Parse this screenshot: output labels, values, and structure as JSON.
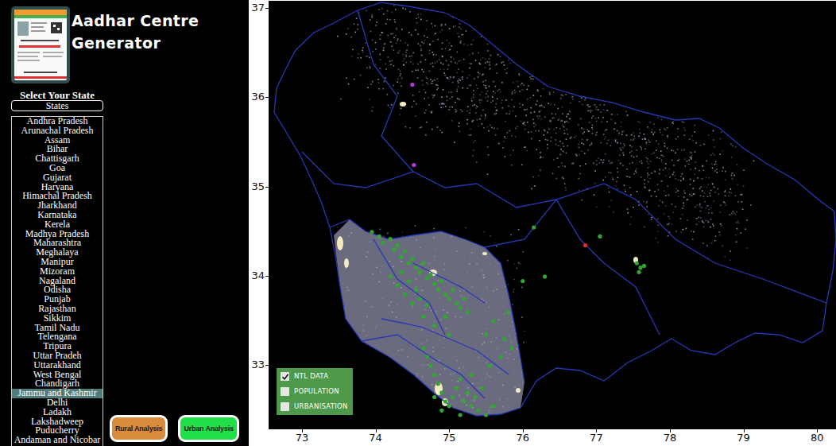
{
  "app": {
    "title": "Aadhar Centre Generator"
  },
  "state_picker": {
    "label": "Select Your State",
    "dropdown": "States"
  },
  "states": [
    {
      "label": "Andhra Pradesh",
      "selected": false
    },
    {
      "label": "Arunachal Pradesh",
      "selected": false
    },
    {
      "label": "Assam",
      "selected": false
    },
    {
      "label": "Bihar",
      "selected": false
    },
    {
      "label": "Chattisgarh",
      "selected": false
    },
    {
      "label": "Goa",
      "selected": false
    },
    {
      "label": "Gujarat",
      "selected": false
    },
    {
      "label": "Haryana",
      "selected": false
    },
    {
      "label": "Himachal Pradesh",
      "selected": false
    },
    {
      "label": "Jharkhand",
      "selected": false
    },
    {
      "label": "Karnataka",
      "selected": false
    },
    {
      "label": "Kerela",
      "selected": false
    },
    {
      "label": "Madhya Pradesh",
      "selected": false
    },
    {
      "label": "Maharashtra",
      "selected": false
    },
    {
      "label": "Meghalaya",
      "selected": false
    },
    {
      "label": "Manipur",
      "selected": false
    },
    {
      "label": "Mizoram",
      "selected": false
    },
    {
      "label": "Nagaland",
      "selected": false
    },
    {
      "label": "Odisha",
      "selected": false
    },
    {
      "label": "Punjab",
      "selected": false
    },
    {
      "label": "Rajasthan",
      "selected": false
    },
    {
      "label": "Sikkim",
      "selected": false
    },
    {
      "label": "Tamil Nadu",
      "selected": false
    },
    {
      "label": "Telengana",
      "selected": false
    },
    {
      "label": "Tripura",
      "selected": false
    },
    {
      "label": "Uttar Pradeh",
      "selected": false
    },
    {
      "label": "Uttarakhand",
      "selected": false
    },
    {
      "label": "West Bengal",
      "selected": false
    },
    {
      "label": "Chandigarh",
      "selected": false
    },
    {
      "label": "Jammu and Kashmir",
      "selected": true
    },
    {
      "label": "Delhi",
      "selected": false
    },
    {
      "label": "Ladakh",
      "selected": false
    },
    {
      "label": "Lakshadweep",
      "selected": false
    },
    {
      "label": "Puducherry",
      "selected": false
    },
    {
      "label": "Andaman and Nicobar",
      "selected": false
    }
  ],
  "buttons": [
    {
      "label": "Rural Analysis",
      "color": "#d98a3b"
    },
    {
      "label": "Urban Analysis",
      "color": "#1fe048"
    }
  ],
  "map": {
    "x_ticks": [
      "73",
      "74",
      "75",
      "76",
      "77",
      "78",
      "79",
      "80"
    ],
    "y_ticks": [
      "37",
      "36",
      "35",
      "34",
      "33"
    ],
    "layers": [
      {
        "label": "NTL DATA",
        "checked": true
      },
      {
        "label": "POPULATION",
        "checked": false
      },
      {
        "label": "URBANISATION",
        "checked": false
      }
    ],
    "series": [
      {
        "color": "#33a532",
        "points": [
          [
            73.95,
            34.5
          ],
          [
            74.05,
            34.45
          ],
          [
            74.1,
            34.38
          ],
          [
            74.2,
            34.42
          ],
          [
            74.25,
            34.3
          ],
          [
            74.3,
            34.35
          ],
          [
            74.35,
            34.22
          ],
          [
            74.4,
            34.28
          ],
          [
            74.45,
            34.15
          ],
          [
            74.5,
            34.2
          ],
          [
            74.55,
            34.1
          ],
          [
            74.6,
            34.05
          ],
          [
            74.65,
            34.15
          ],
          [
            74.7,
            33.98
          ],
          [
            74.75,
            34.02
          ],
          [
            74.8,
            33.92
          ],
          [
            74.85,
            33.85
          ],
          [
            74.9,
            33.95
          ],
          [
            74.95,
            33.8
          ],
          [
            75.0,
            33.75
          ],
          [
            75.05,
            33.85
          ],
          [
            75.1,
            33.7
          ],
          [
            75.15,
            33.65
          ],
          [
            75.2,
            33.75
          ],
          [
            75.25,
            33.6
          ],
          [
            74.35,
            34.05
          ],
          [
            74.45,
            33.95
          ],
          [
            74.55,
            33.85
          ],
          [
            74.6,
            33.75
          ],
          [
            74.7,
            33.68
          ],
          [
            74.2,
            34.0
          ],
          [
            74.3,
            33.9
          ],
          [
            74.4,
            33.8
          ],
          [
            74.5,
            33.7
          ],
          [
            74.65,
            33.55
          ],
          [
            74.8,
            33.45
          ],
          [
            75.0,
            33.35
          ],
          [
            74.95,
            33.55
          ],
          [
            74.65,
            33.2
          ],
          [
            74.7,
            33.1
          ],
          [
            74.75,
            33.0
          ],
          [
            74.8,
            32.9
          ],
          [
            74.85,
            32.8
          ],
          [
            74.9,
            32.7
          ],
          [
            74.95,
            32.6
          ],
          [
            75.0,
            32.55
          ],
          [
            75.05,
            32.65
          ],
          [
            75.1,
            32.75
          ],
          [
            75.15,
            32.85
          ],
          [
            75.2,
            32.6
          ],
          [
            75.25,
            32.7
          ],
          [
            75.3,
            32.55
          ],
          [
            75.35,
            32.65
          ],
          [
            75.4,
            32.5
          ],
          [
            74.8,
            32.65
          ],
          [
            74.9,
            32.5
          ],
          [
            75.5,
            32.45
          ],
          [
            75.15,
            32.45
          ],
          [
            75.6,
            32.55
          ],
          [
            75.45,
            32.75
          ],
          [
            75.3,
            32.9
          ],
          [
            75.55,
            33.0
          ],
          [
            75.7,
            33.1
          ],
          [
            75.6,
            33.5
          ],
          [
            75.75,
            33.3
          ],
          [
            75.85,
            33.2
          ],
          [
            75.5,
            33.35
          ],
          [
            75.8,
            33.6
          ],
          [
            76.0,
            33.95
          ],
          [
            76.15,
            34.55
          ],
          [
            76.3,
            34.0
          ],
          [
            77.55,
            34.15
          ],
          [
            77.6,
            34.1
          ],
          [
            77.65,
            34.12
          ],
          [
            77.58,
            34.05
          ],
          [
            77.05,
            34.45
          ]
        ]
      },
      {
        "color": "#e02b2b",
        "points": [
          [
            76.85,
            34.35
          ]
        ]
      },
      {
        "color": "#b03ad8",
        "points": [
          [
            74.52,
            35.25
          ],
          [
            74.5,
            36.15
          ]
        ]
      }
    ]
  }
}
